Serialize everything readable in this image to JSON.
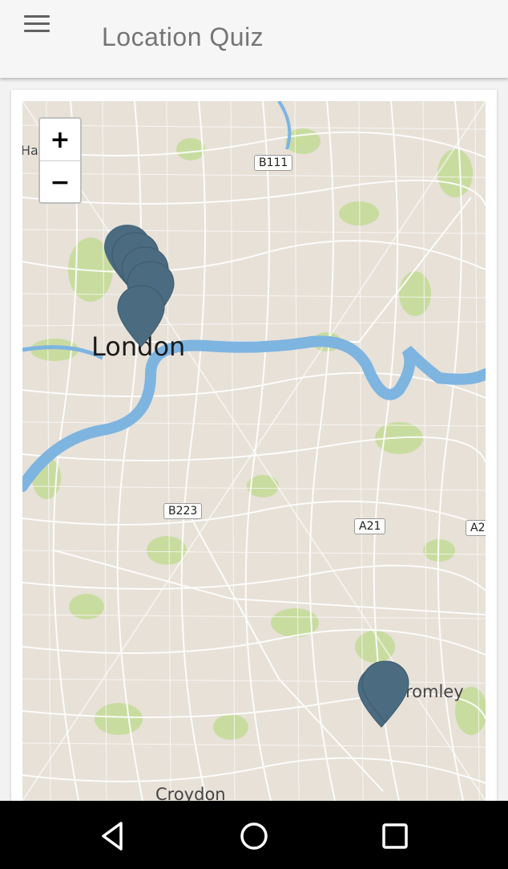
{
  "app": {
    "title": "Location Quiz"
  },
  "map": {
    "zoom_in_label": "+",
    "zoom_out_label": "−",
    "places": {
      "london": "London",
      "bromley": "romley",
      "croydon": "Croydon",
      "hampstead": "Ha    ad"
    },
    "roads": {
      "b111": "B111",
      "b223": "B223",
      "a21": "A21",
      "a2": "A2"
    },
    "marker_color": "#4a6b80",
    "river_color": "#7eb4e0",
    "park_color": "#c9dca0"
  },
  "nav": {
    "back": "back-icon",
    "home": "home-icon",
    "recents": "recents-icon"
  }
}
